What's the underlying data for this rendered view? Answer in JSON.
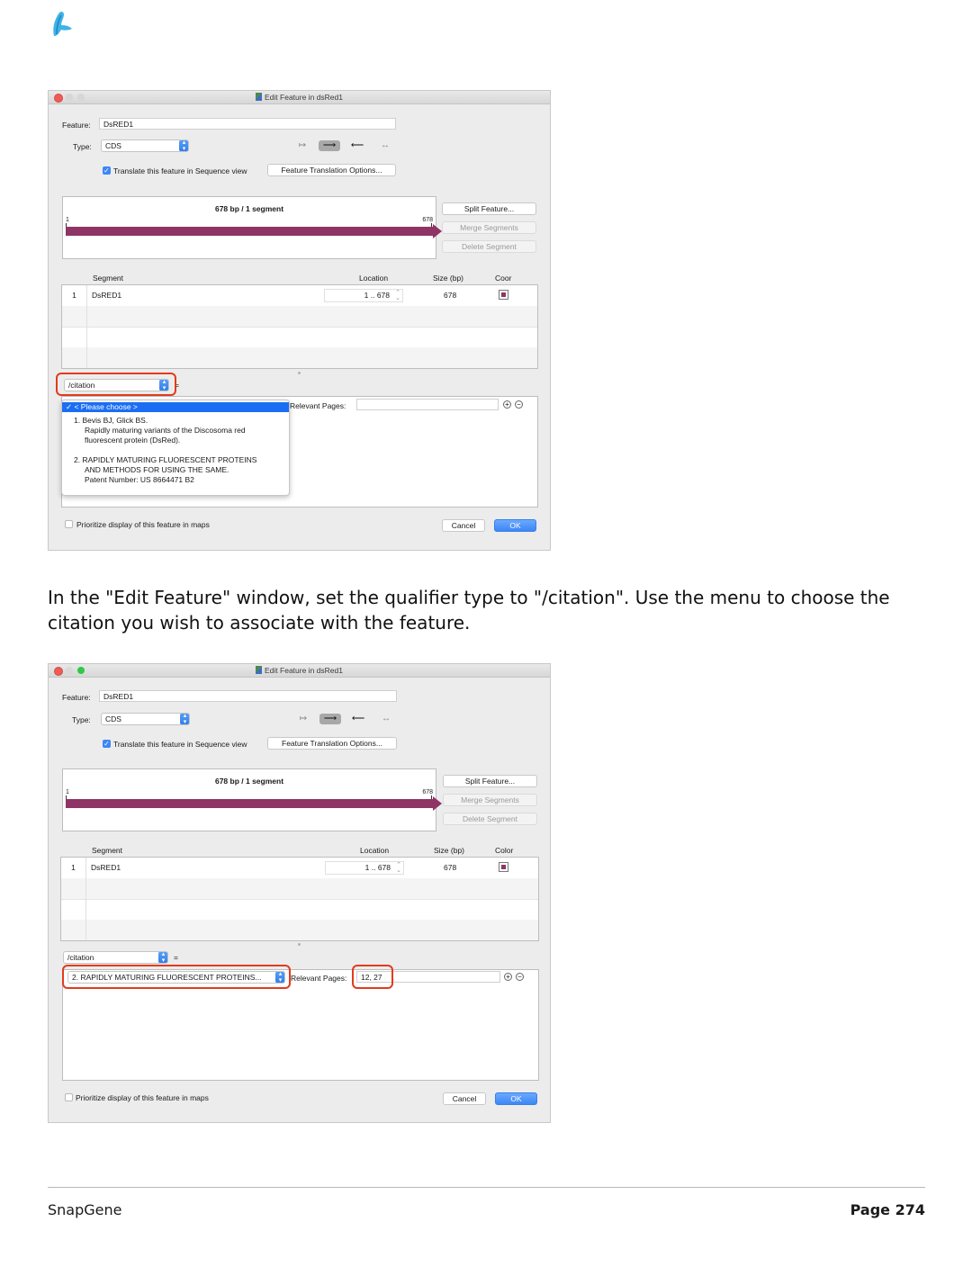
{
  "window": {
    "title": "Edit Feature in dsRed1",
    "feature_label": "Feature:",
    "feature_value": "DsRED1",
    "type_label": "Type:",
    "type_value": "CDS",
    "translate_label": "Translate this feature in Sequence view",
    "translation_options_label": "Feature Translation Options...",
    "map_header": "678 bp  /  1 segment",
    "map_start": "1",
    "map_end": "678",
    "split_label": "Split Feature...",
    "merge_label": "Merge Segments",
    "delete_label": "Delete Segment",
    "seg_headers": {
      "segment": "Segment",
      "location": "Location",
      "size": "Size (bp)",
      "color_1": "Coor",
      "color_2": "Color"
    },
    "segment_row": {
      "index": "1",
      "name": "DsRED1",
      "location": "1  ..  678",
      "size": "678"
    },
    "qualifier_value": "/citation",
    "equals": "=",
    "relevant_pages_label": "Relevant Pages:",
    "relevant_pages_value": "12, 27",
    "prioritize_label": "Prioritize display of this feature in maps",
    "cancel_label": "Cancel",
    "ok_label": "OK",
    "plus": "+",
    "minus": "−",
    "citation_selected": "2.  RAPIDLY MATURING FLUORESCENT PROTEINS..."
  },
  "citation_menu": {
    "selected": "✓ < Please choose >",
    "item1_line1": "1.  Bevis BJ, Glick BS.",
    "item1_line2": "Rapidly maturing variants of the Discosoma red",
    "item1_line3": "fluorescent protein (DsRed).",
    "item2_line1": "2.  RAPIDLY MATURING FLUORESCENT PROTEINS",
    "item2_line2": "AND METHODS FOR USING THE SAME.",
    "item2_line3": "Patent Number:  US 8664471 B2"
  },
  "caption": "In the \"Edit Feature\" window, set the qualifier type to \"/citation\". Use the menu to choose the citation you wish to associate with the feature.",
  "footer": {
    "left": "SnapGene",
    "right": "Page 274"
  },
  "colors": {
    "feature": "#8e3566",
    "highlight": "#e23b1c",
    "accent": "#3e87f5"
  },
  "icons": {
    "logo": "snapgene-logo-icon",
    "window": "feature-file-icon"
  }
}
